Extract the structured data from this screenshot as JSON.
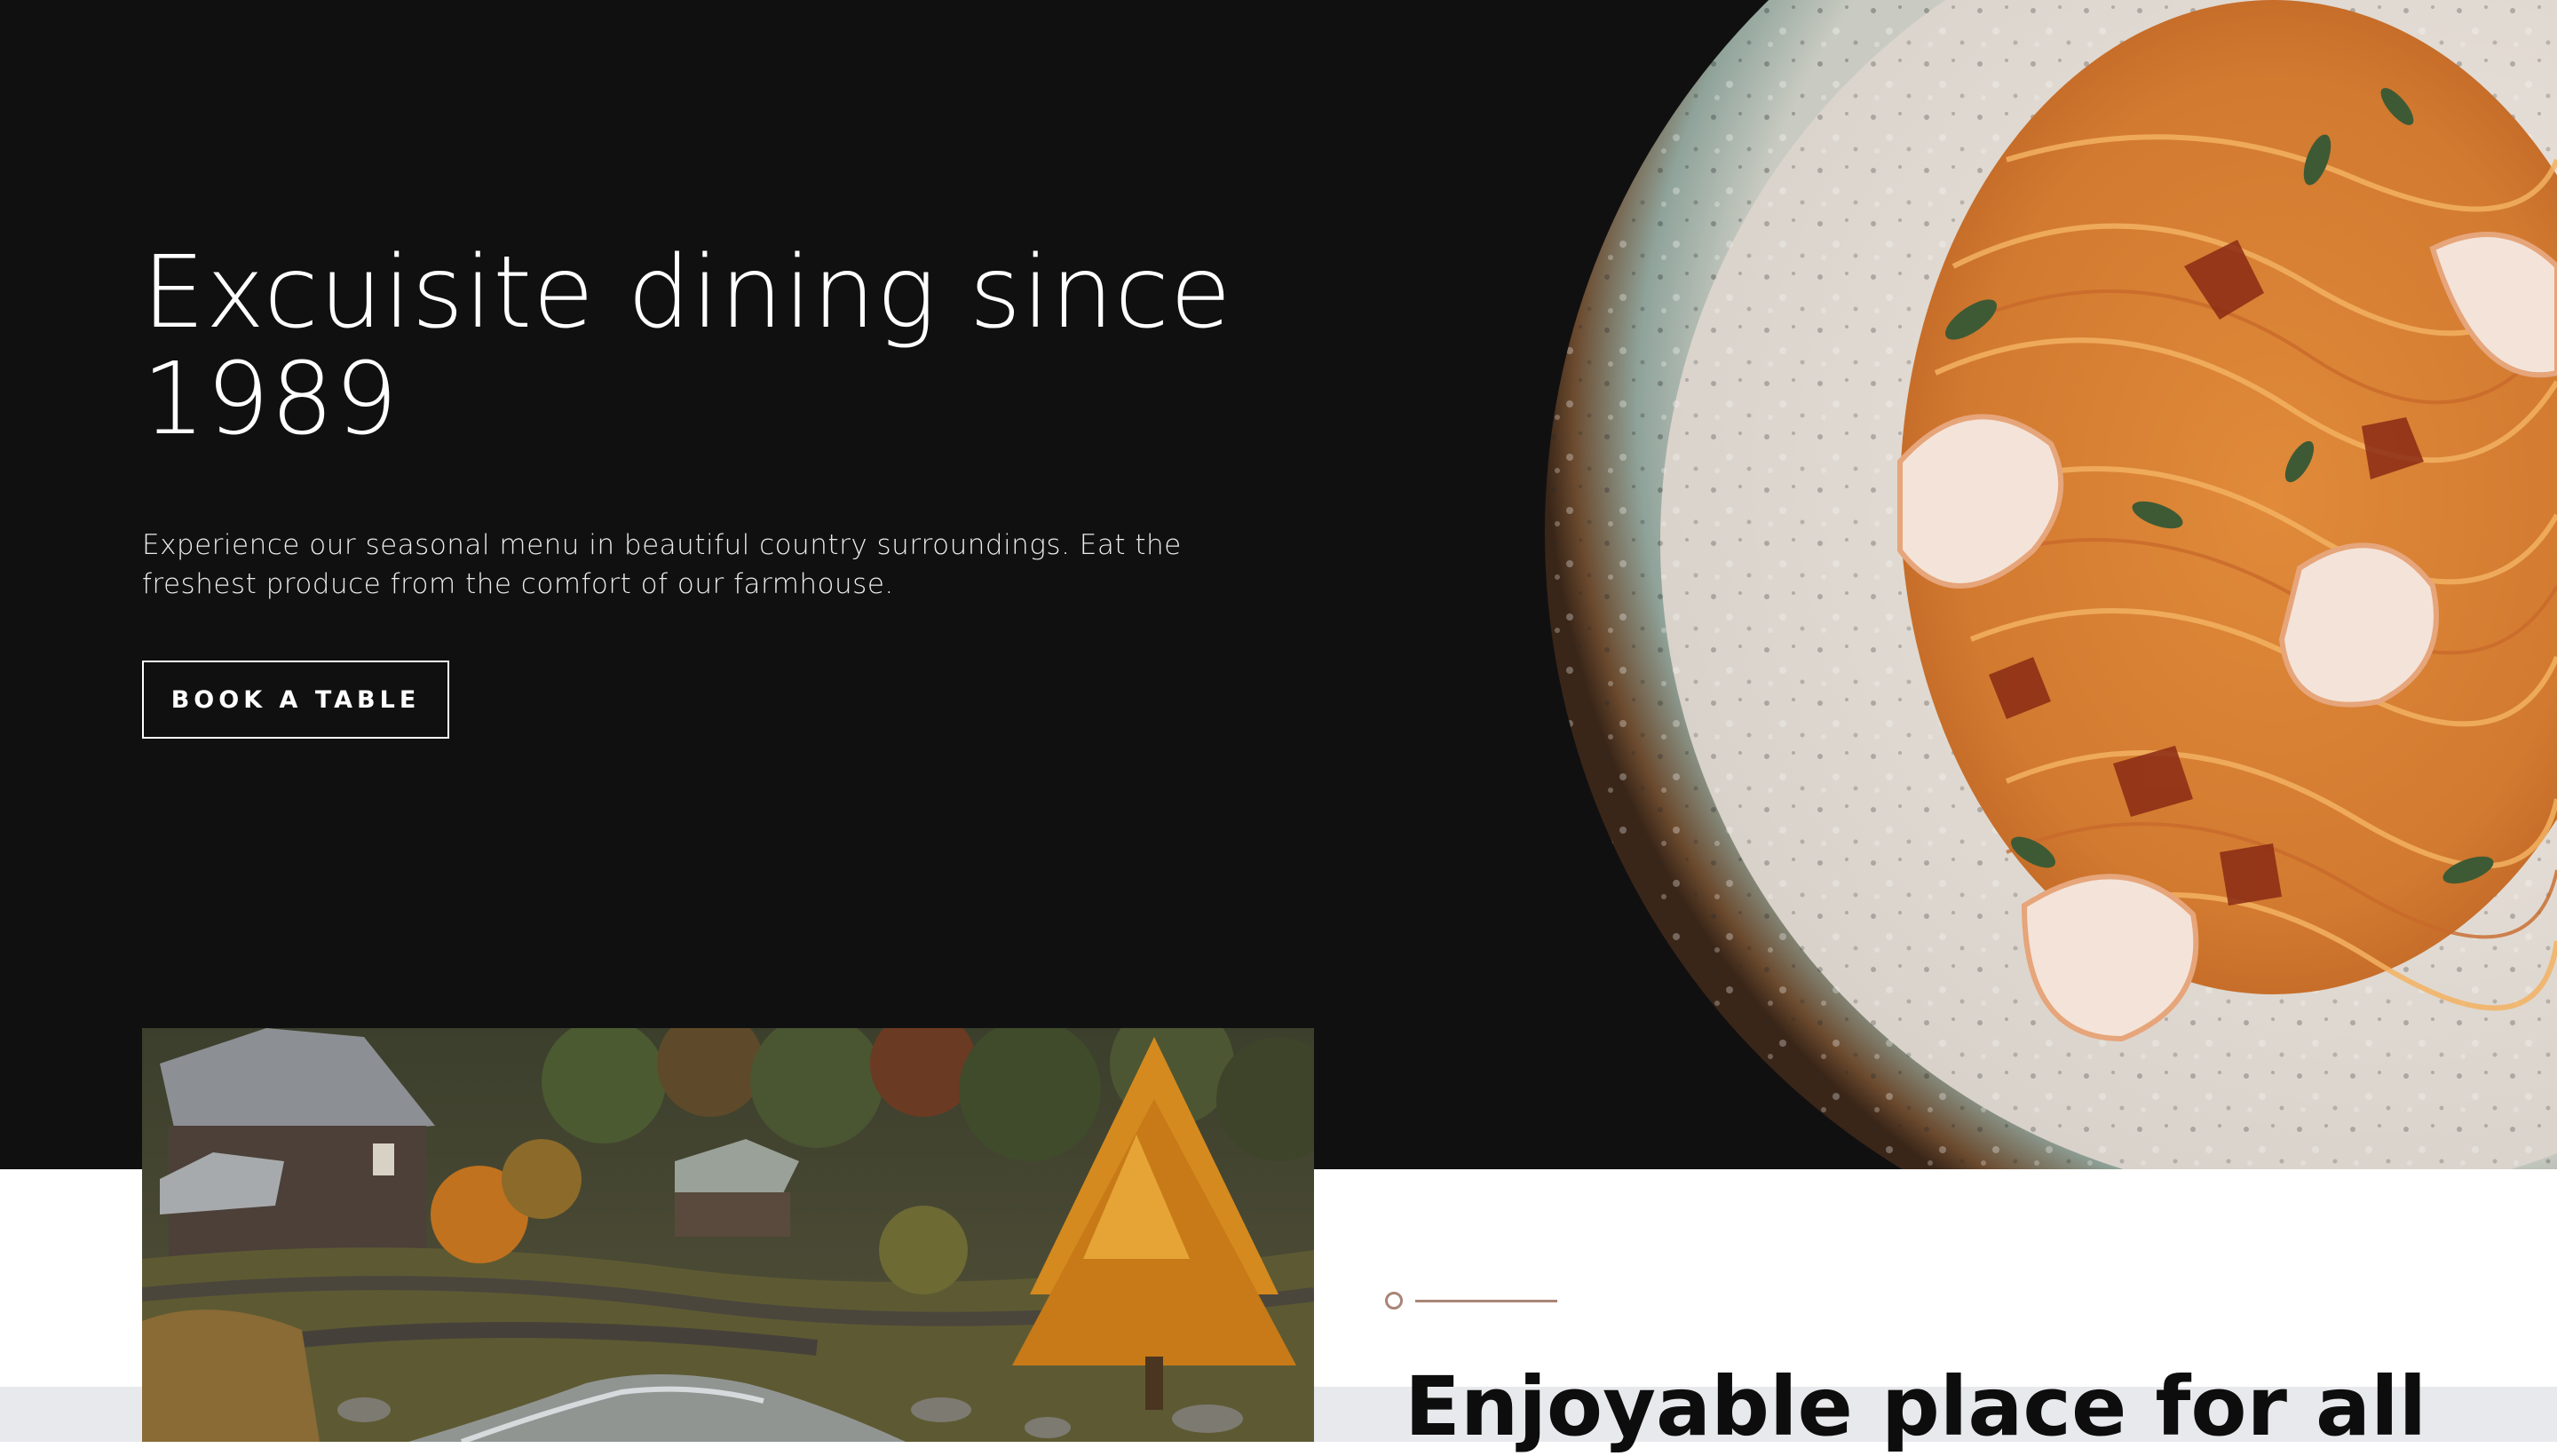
{
  "hero": {
    "title": "Excuisite dining since 1989",
    "description": "Experience our seasonal menu in beautiful country surroundings. Eat the freshest produce from the comfort of our farmhouse.",
    "cta_label": "BOOK A TABLE"
  },
  "about": {
    "title": "Enjoyable place for all"
  },
  "colors": {
    "hero_background": "#111011",
    "accent": "#a98577",
    "text_light": "#ffffff",
    "text_dark": "#0d0d0d"
  }
}
